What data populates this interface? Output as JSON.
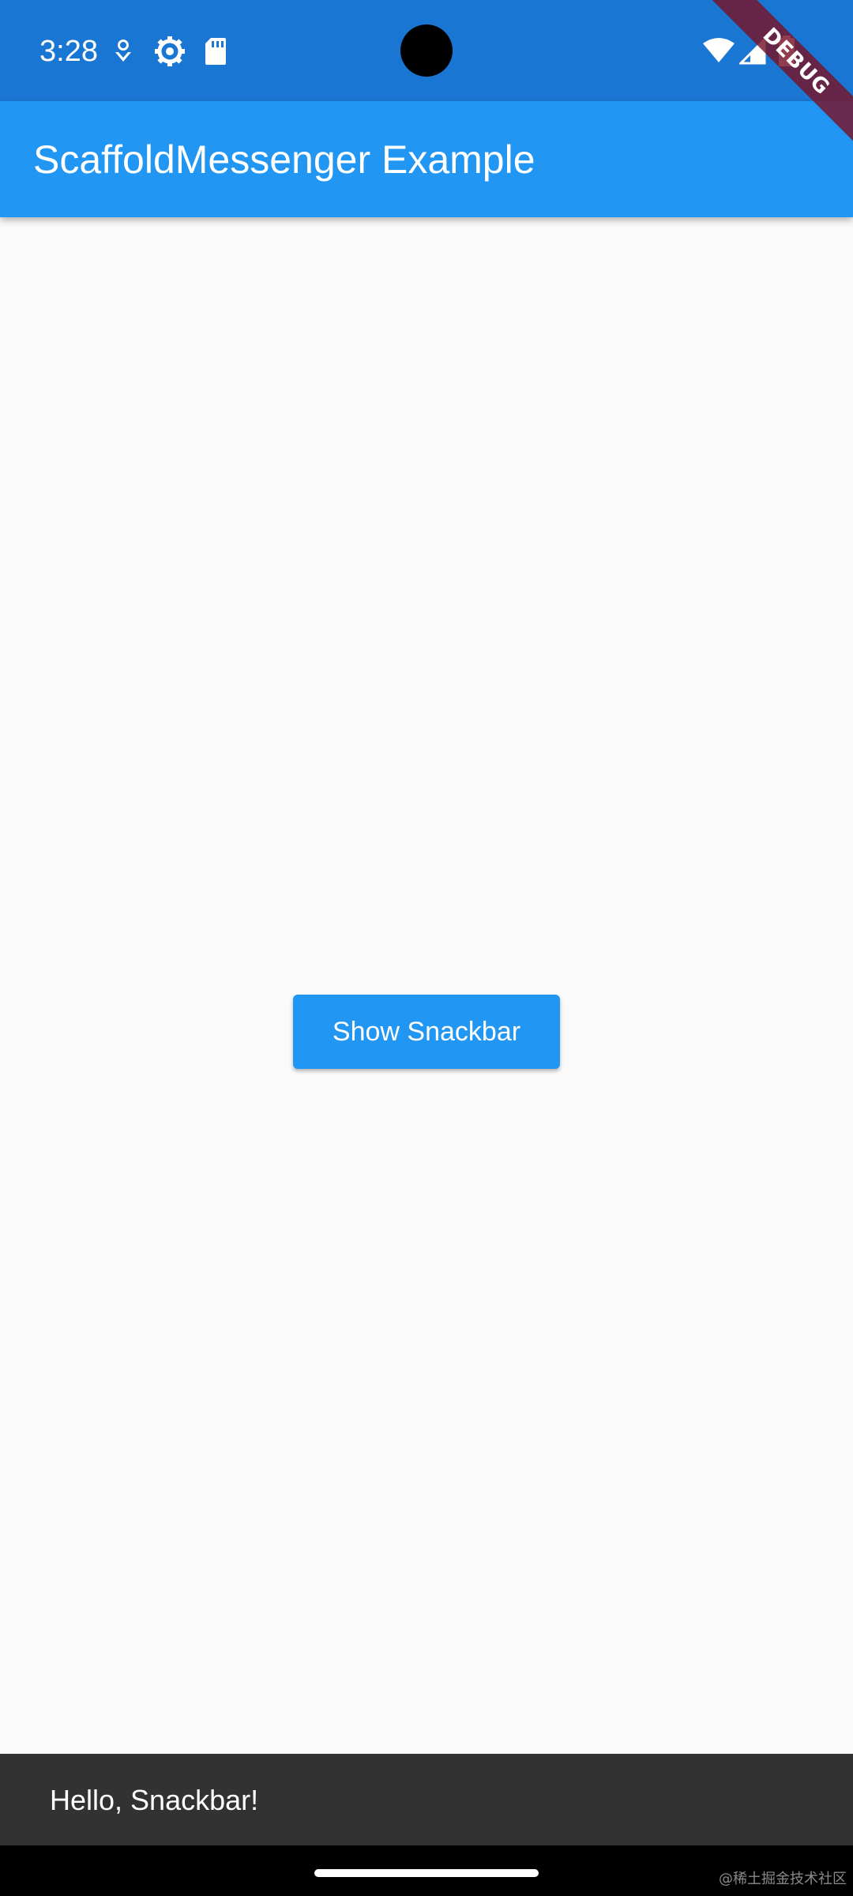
{
  "status_bar": {
    "time": "3:28",
    "icons_left": [
      "location-pin-icon",
      "settings-gear-icon",
      "sd-card-icon"
    ],
    "icons_right": [
      "wifi-icon",
      "cellular-signal-icon",
      "battery-icon"
    ]
  },
  "debug_banner": {
    "label": "DEBUG"
  },
  "app_bar": {
    "title": "ScaffoldMessenger Example"
  },
  "main": {
    "button_label": "Show Snackbar"
  },
  "snackbar": {
    "message": "Hello, Snackbar!"
  },
  "watermark": "@稀土掘金技术社区",
  "colors": {
    "status_bar": "#1976d2",
    "app_bar": "#2196f3",
    "button": "#2196f3",
    "background": "#fafafa",
    "snackbar": "#323232",
    "debug_banner": "#78142a"
  }
}
